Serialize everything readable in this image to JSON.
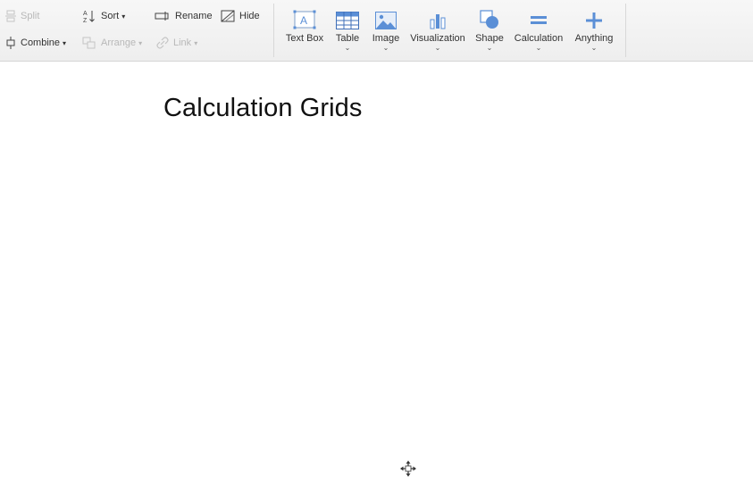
{
  "toolbar": {
    "organize": {
      "split": "Split",
      "sort": "Sort",
      "rename": "Rename",
      "hide": "Hide",
      "combine": "Combine",
      "arrange": "Arrange",
      "link": "Link"
    },
    "insert": [
      {
        "label": "Text Box",
        "icon": "text-box-icon",
        "has_menu": false
      },
      {
        "label": "Table",
        "icon": "table-icon",
        "has_menu": true
      },
      {
        "label": "Image",
        "icon": "image-icon",
        "has_menu": true
      },
      {
        "label": "Visualization",
        "icon": "bar-chart-icon",
        "has_menu": true
      },
      {
        "label": "Shape",
        "icon": "shape-icon",
        "has_menu": true
      },
      {
        "label": "Calculation",
        "icon": "equals-icon",
        "has_menu": true
      },
      {
        "label": "Anything",
        "icon": "plus-icon",
        "has_menu": true
      }
    ],
    "chevron": "⌄",
    "accent": "#5b8fd6"
  },
  "document": {
    "title": "Calculation Grids"
  }
}
